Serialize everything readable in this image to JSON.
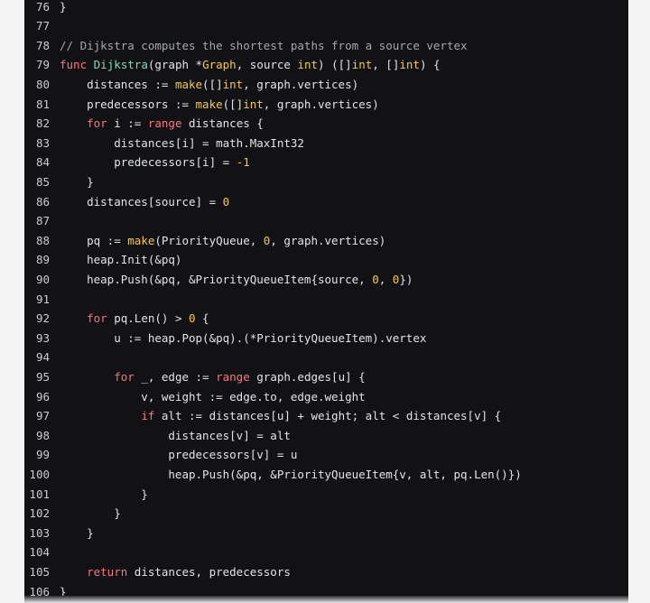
{
  "colors": {
    "background": "#121215",
    "page": "#f4f4f5",
    "text": "#e1e4e8",
    "line_number": "#c9ccd1",
    "comment": "#a4a8ae",
    "keyword": "#f97583",
    "function": "#86d9b7",
    "type": "#f2c94c",
    "number": "#f2c94c"
  },
  "lines": [
    {
      "num": "76",
      "tokens": [
        {
          "t": "}",
          "c": ""
        }
      ]
    },
    {
      "num": "77",
      "tokens": []
    },
    {
      "num": "78",
      "tokens": [
        {
          "t": "// Dijkstra computes the shortest paths from a source vertex",
          "c": "c"
        }
      ]
    },
    {
      "num": "79",
      "tokens": [
        {
          "t": "func ",
          "c": "k"
        },
        {
          "t": "Dijkstra",
          "c": "f"
        },
        {
          "t": "(graph *",
          "c": ""
        },
        {
          "t": "Graph",
          "c": "t"
        },
        {
          "t": ", source ",
          "c": ""
        },
        {
          "t": "int",
          "c": "t"
        },
        {
          "t": ") ([]",
          "c": ""
        },
        {
          "t": "int",
          "c": "t"
        },
        {
          "t": ", []",
          "c": ""
        },
        {
          "t": "int",
          "c": "t"
        },
        {
          "t": ") {",
          "c": ""
        }
      ]
    },
    {
      "num": "80",
      "tokens": [
        {
          "t": "    distances := ",
          "c": ""
        },
        {
          "t": "make",
          "c": "t"
        },
        {
          "t": "([]",
          "c": ""
        },
        {
          "t": "int",
          "c": "t"
        },
        {
          "t": ", graph.vertices)",
          "c": ""
        }
      ]
    },
    {
      "num": "81",
      "tokens": [
        {
          "t": "    predecessors := ",
          "c": ""
        },
        {
          "t": "make",
          "c": "t"
        },
        {
          "t": "([]",
          "c": ""
        },
        {
          "t": "int",
          "c": "t"
        },
        {
          "t": ", graph.vertices)",
          "c": ""
        }
      ]
    },
    {
      "num": "82",
      "tokens": [
        {
          "t": "    ",
          "c": ""
        },
        {
          "t": "for",
          "c": "k"
        },
        {
          "t": " i := ",
          "c": ""
        },
        {
          "t": "range",
          "c": "k"
        },
        {
          "t": " distances {",
          "c": ""
        }
      ]
    },
    {
      "num": "83",
      "tokens": [
        {
          "t": "        distances[i] = math.MaxInt32",
          "c": ""
        }
      ]
    },
    {
      "num": "84",
      "tokens": [
        {
          "t": "        predecessors[i] = ",
          "c": ""
        },
        {
          "t": "-1",
          "c": "n"
        }
      ]
    },
    {
      "num": "85",
      "tokens": [
        {
          "t": "    }",
          "c": ""
        }
      ]
    },
    {
      "num": "86",
      "tokens": [
        {
          "t": "    distances[source] = ",
          "c": ""
        },
        {
          "t": "0",
          "c": "n"
        }
      ]
    },
    {
      "num": "87",
      "tokens": []
    },
    {
      "num": "88",
      "tokens": [
        {
          "t": "    pq := ",
          "c": ""
        },
        {
          "t": "make",
          "c": "t"
        },
        {
          "t": "(PriorityQueue, ",
          "c": ""
        },
        {
          "t": "0",
          "c": "n"
        },
        {
          "t": ", graph.vertices)",
          "c": ""
        }
      ]
    },
    {
      "num": "89",
      "tokens": [
        {
          "t": "    heap.Init(&pq)",
          "c": ""
        }
      ]
    },
    {
      "num": "90",
      "tokens": [
        {
          "t": "    heap.Push(&pq, &PriorityQueueItem{source, ",
          "c": ""
        },
        {
          "t": "0",
          "c": "n"
        },
        {
          "t": ", ",
          "c": ""
        },
        {
          "t": "0",
          "c": "n"
        },
        {
          "t": "})",
          "c": ""
        }
      ]
    },
    {
      "num": "91",
      "tokens": []
    },
    {
      "num": "92",
      "tokens": [
        {
          "t": "    ",
          "c": ""
        },
        {
          "t": "for",
          "c": "k"
        },
        {
          "t": " pq.Len() > ",
          "c": ""
        },
        {
          "t": "0",
          "c": "n"
        },
        {
          "t": " {",
          "c": ""
        }
      ]
    },
    {
      "num": "93",
      "tokens": [
        {
          "t": "        u := heap.Pop(&pq).(*PriorityQueueItem).vertex",
          "c": ""
        }
      ]
    },
    {
      "num": "94",
      "tokens": []
    },
    {
      "num": "95",
      "tokens": [
        {
          "t": "        ",
          "c": ""
        },
        {
          "t": "for",
          "c": "k"
        },
        {
          "t": " _, edge := ",
          "c": ""
        },
        {
          "t": "range",
          "c": "k"
        },
        {
          "t": " graph.edges[u] {",
          "c": ""
        }
      ]
    },
    {
      "num": "96",
      "tokens": [
        {
          "t": "            v, weight := edge.to, edge.weight",
          "c": ""
        }
      ]
    },
    {
      "num": "97",
      "tokens": [
        {
          "t": "            ",
          "c": ""
        },
        {
          "t": "if",
          "c": "k"
        },
        {
          "t": " alt := distances[u] + weight; alt < distances[v] {",
          "c": ""
        }
      ]
    },
    {
      "num": "98",
      "tokens": [
        {
          "t": "                distances[v] = alt",
          "c": ""
        }
      ]
    },
    {
      "num": "99",
      "tokens": [
        {
          "t": "                predecessors[v] = u",
          "c": ""
        }
      ]
    },
    {
      "num": "100",
      "tokens": [
        {
          "t": "                heap.Push(&pq, &PriorityQueueItem{v, alt, pq.Len()})",
          "c": ""
        }
      ]
    },
    {
      "num": "101",
      "tokens": [
        {
          "t": "            }",
          "c": ""
        }
      ]
    },
    {
      "num": "102",
      "tokens": [
        {
          "t": "        }",
          "c": ""
        }
      ]
    },
    {
      "num": "103",
      "tokens": [
        {
          "t": "    }",
          "c": ""
        }
      ]
    },
    {
      "num": "104",
      "tokens": []
    },
    {
      "num": "105",
      "tokens": [
        {
          "t": "    ",
          "c": ""
        },
        {
          "t": "return",
          "c": "k"
        },
        {
          "t": " distances, predecessors",
          "c": ""
        }
      ]
    },
    {
      "num": "106",
      "tokens": [
        {
          "t": "}",
          "c": ""
        }
      ]
    }
  ]
}
